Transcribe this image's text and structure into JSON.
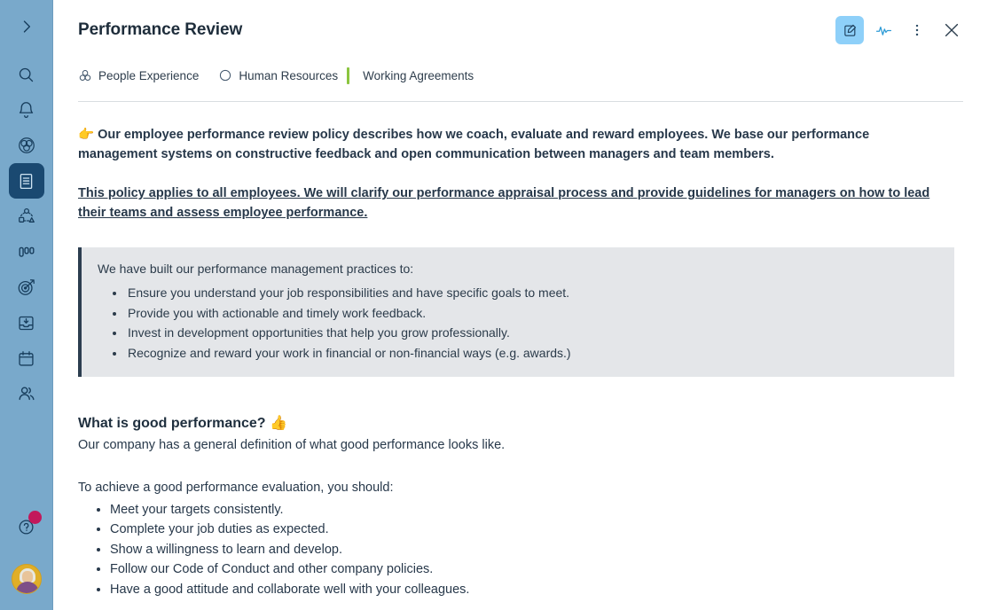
{
  "sidebar": {
    "expand_label": "Expand navigation",
    "items": [
      {
        "name": "expand",
        "icon": "chevron-right-icon",
        "label": "Expand",
        "active": false
      },
      {
        "name": "search",
        "icon": "search-icon",
        "label": "Search",
        "active": false
      },
      {
        "name": "notifications",
        "icon": "bell-icon",
        "label": "Notifications",
        "active": false
      },
      {
        "name": "company",
        "icon": "circles-icon",
        "label": "Company",
        "active": false
      },
      {
        "name": "documents",
        "icon": "document-icon",
        "label": "Documents",
        "active": true
      },
      {
        "name": "org-chart",
        "icon": "org-chart-icon",
        "label": "Org Chart",
        "active": false
      },
      {
        "name": "boards",
        "icon": "kanban-columns-icon",
        "label": "Boards",
        "active": false
      },
      {
        "name": "goals",
        "icon": "target-icon",
        "label": "Goals",
        "active": false
      },
      {
        "name": "inbox",
        "icon": "inbox-icon",
        "label": "Inbox",
        "active": false
      },
      {
        "name": "calendar",
        "icon": "calendar-icon",
        "label": "Calendar",
        "active": false
      },
      {
        "name": "people",
        "icon": "people-icon",
        "label": "People",
        "active": false
      }
    ],
    "help": {
      "icon": "help-question-icon",
      "label": "Help",
      "badge": true
    },
    "avatar": {
      "label": "User profile",
      "ring_color": "#e0ae28"
    }
  },
  "header": {
    "title": "Performance Review",
    "actions": [
      {
        "name": "edit",
        "icon": "edit-pencil-icon",
        "label": "Edit",
        "active": true,
        "color": "#8ed0f9"
      },
      {
        "name": "activity",
        "icon": "activity-pulse-icon",
        "label": "Activity",
        "active": false,
        "color": "#2e9bd6"
      },
      {
        "name": "more",
        "icon": "more-vertical-icon",
        "label": "More options",
        "active": false
      },
      {
        "name": "close",
        "icon": "close-x-icon",
        "label": "Close",
        "active": false
      }
    ]
  },
  "breadcrumb": {
    "items": [
      {
        "label": "People Experience",
        "icon": "three-circles-icon"
      },
      {
        "label": "Human Resources",
        "icon": "circle-outline-icon"
      },
      {
        "label": "Working Agreements",
        "icon": "",
        "accent_color": "#8bc53f",
        "current": true
      }
    ]
  },
  "content": {
    "intro_emoji": "👉",
    "intro_paragraph": "Our employee performance review policy describes how we coach, evaluate and reward employees. We base our performance management systems on constructive feedback and open communication between managers and team members.",
    "scope_paragraph": "This policy applies to all employees. We will clarify our performance appraisal process and provide guidelines for managers on how to lead their teams and assess employee performance.",
    "callout": {
      "lead": "We have built our performance management practices to:",
      "items": [
        "Ensure you understand your job responsibilities and have specific goals to meet.",
        "Provide you with actionable and timely work feedback.",
        "Invest in development opportunities that help you grow professionally.",
        "Recognize and reward your work in financial or non-financial ways (e.g. awards.)"
      ],
      "background_color": "#e4e6e9",
      "border_color": "#2c3e50"
    },
    "section": {
      "heading": "What is good performance?",
      "heading_emoji": "👍",
      "subtitle": "Our company has a general definition of what good performance looks like.",
      "lead": "To achieve a good performance evaluation, you should:",
      "items": [
        "Meet your targets consistently.",
        "Complete your job duties as expected.",
        "Show a willingness to learn and develop.",
        "Follow our Code of Conduct and other company policies.",
        "Have a good attitude and collaborate well with your colleagues."
      ]
    }
  }
}
